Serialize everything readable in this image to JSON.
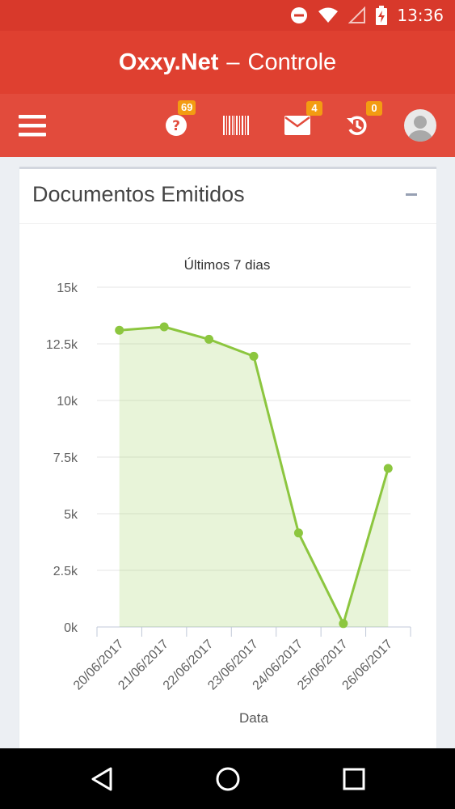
{
  "status_bar": {
    "time": "13:36"
  },
  "header": {
    "brand": "Oxxy.Net",
    "separator": "–",
    "subtitle": "Controle"
  },
  "toolbar": {
    "help_badge": "69",
    "messages_badge": "4",
    "history_badge": "0"
  },
  "card": {
    "title": "Documentos Emitidos"
  },
  "colors": {
    "header": "#df4030",
    "badge": "#f39c12",
    "series": "#8cc63f"
  },
  "chart_data": {
    "type": "area",
    "title": "Últimos 7 dias",
    "xlabel": "Data",
    "ylabel": "",
    "categories": [
      "20/06/2017",
      "21/06/2017",
      "22/06/2017",
      "23/06/2017",
      "24/06/2017",
      "25/06/2017",
      "26/06/2017"
    ],
    "values": [
      13100,
      13250,
      12700,
      11950,
      4150,
      150,
      7000
    ],
    "ylim": [
      0,
      15000
    ],
    "yticks": [
      0,
      2500,
      5000,
      7500,
      10000,
      12500,
      15000
    ],
    "ytick_labels": [
      "0k",
      "2.5k",
      "5k",
      "7.5k",
      "10k",
      "12.5k",
      "15k"
    ],
    "grid": true,
    "legend": "none"
  }
}
